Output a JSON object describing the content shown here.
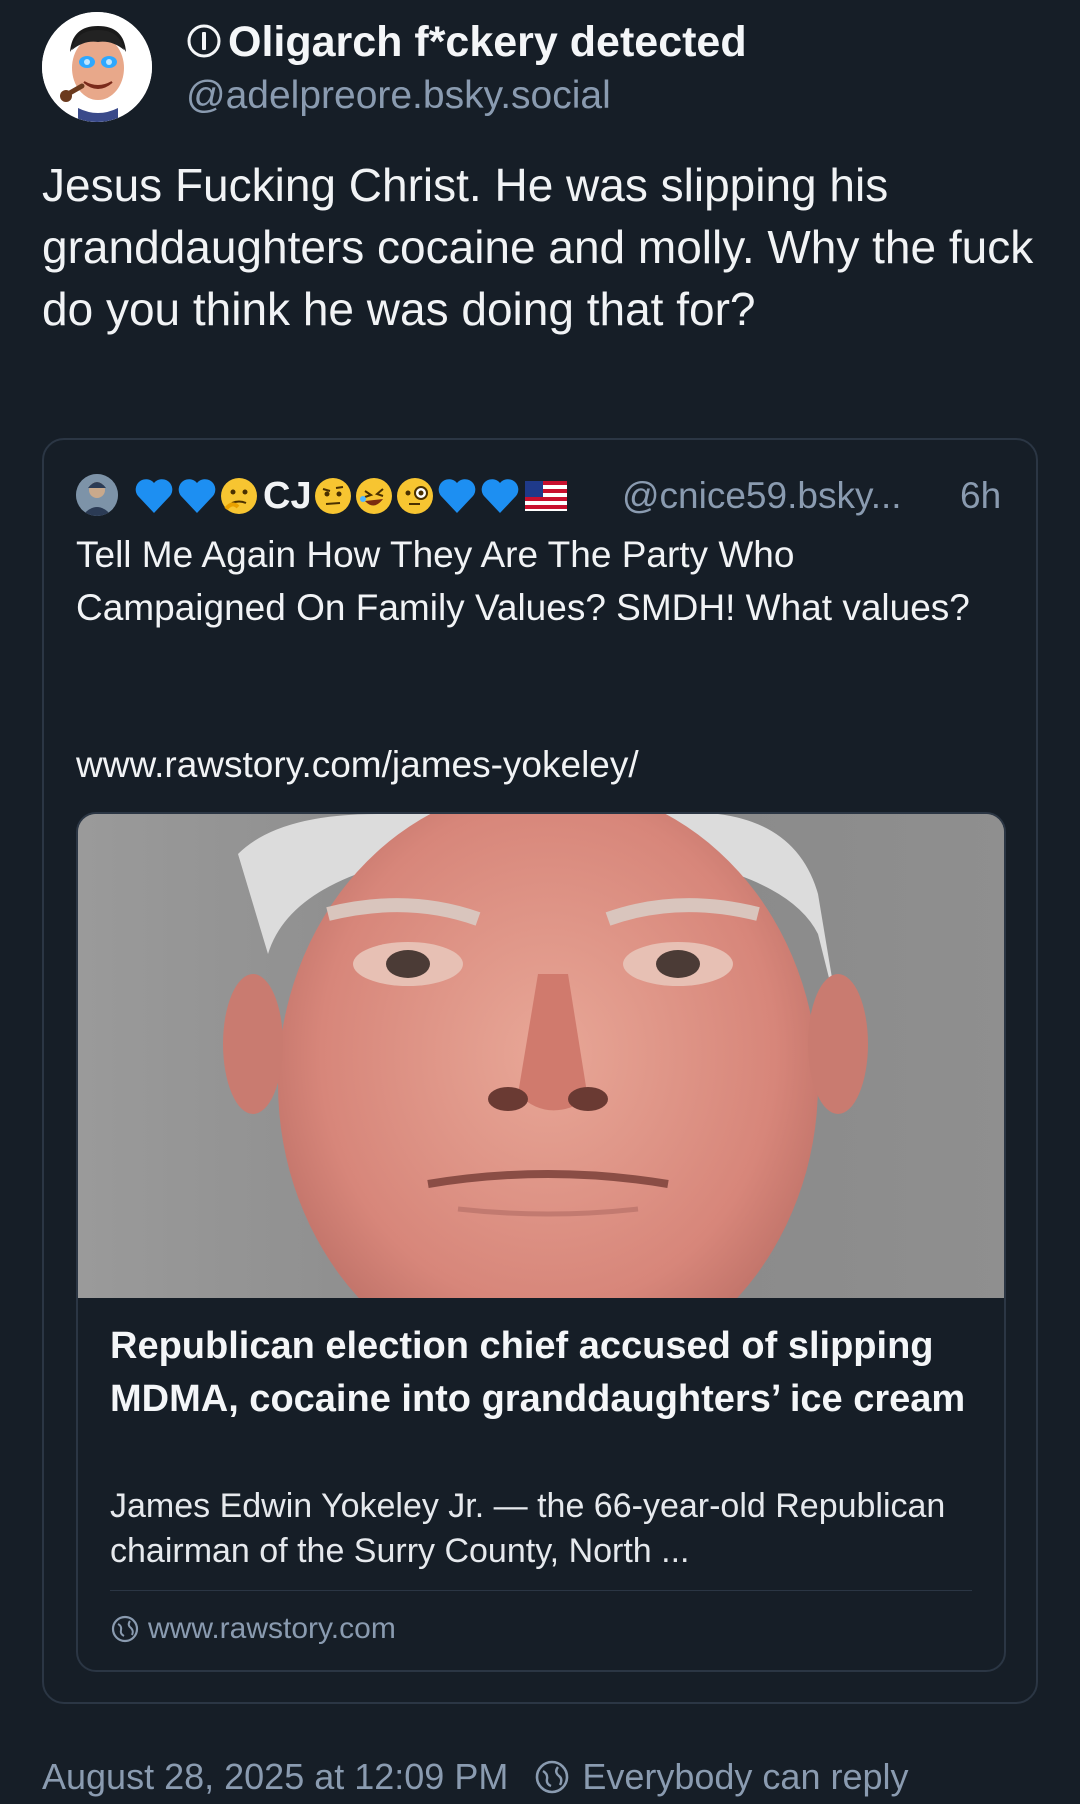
{
  "author": {
    "display_name": "Oligarch f*ckery detected",
    "handle": "@adelpreore.bsky.social"
  },
  "post": {
    "text": "Jesus Fucking Christ. He was slipping his granddaughters cocaine and molly. Why the fuck do you think he was doing that for?"
  },
  "quote": {
    "author_name": "CJ",
    "handle": "@cnice59.bsky...",
    "time": "6h",
    "text": "Tell Me Again How They Are The Party Who Campaigned  On Family Values?  SMDH!  What values?",
    "link_text": "www.rawstory.com/james-yokeley/",
    "embed": {
      "title": "Republican election chief accused of slipping MDMA, cocaine into granddaughters’ ice cream",
      "description": "James Edwin Yokeley Jr. — the 66-year-old Republican chairman of the Surry County, North ...",
      "domain": "www.rawstory.com"
    }
  },
  "footer": {
    "timestamp": "August 28, 2025 at 12:09 PM",
    "reply_permission": "Everybody can reply"
  },
  "colors": {
    "background": "#161e27",
    "muted_text": "#8a9bb0",
    "border": "#2b3644",
    "heart_blue": "#1d8ff2"
  }
}
